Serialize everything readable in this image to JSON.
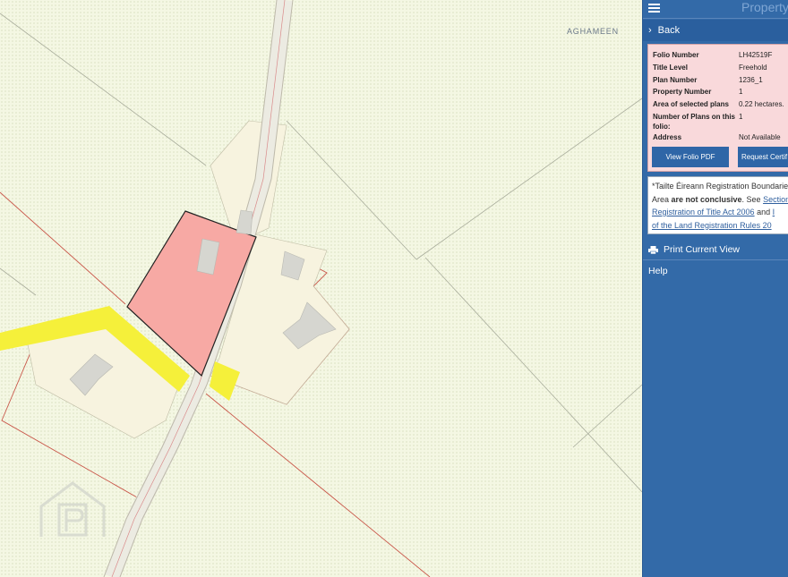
{
  "map": {
    "townland_label": "AGHAMEEN",
    "watermark_icon": "property-logo-icon"
  },
  "panel": {
    "menu_icon": "hamburger-icon",
    "title": "Property",
    "back_label": "Back",
    "folio": {
      "rows": [
        {
          "label": "Folio Number",
          "value": "LH42519F"
        },
        {
          "label": "Title Level",
          "value": "Freehold"
        },
        {
          "label": "Plan Number",
          "value": "1236_1"
        },
        {
          "label": "Property Number",
          "value": "1"
        },
        {
          "label": "Area of selected plans",
          "value": "0.22 hectares."
        },
        {
          "label": "Number of Plans on this folio:",
          "value": "1"
        },
        {
          "label": "Address",
          "value": "Not Available"
        }
      ],
      "view_pdf_label": "View Folio PDF",
      "request_cert_label": "Request Certif"
    },
    "disclaimer": {
      "line1": "*Tailte Éireann Registration Boundarie",
      "line2_prefix": "Area ",
      "line2_bold": "are not conclusive",
      "line2_mid": ". See ",
      "line2_link": "Section",
      "line3_link": "Registration of Title Act 2006",
      "line3_mid": " and ",
      "line3_tail": "I",
      "line4_link": "of the Land Registration Rules 20"
    },
    "print_label": "Print Current View",
    "help_label": "Help"
  },
  "colors": {
    "panel_bg": "#336aa8",
    "selected_parcel": "#f7a9a4",
    "road_highlight": "#f5f03a",
    "info_card_bg": "#f9d9db"
  }
}
